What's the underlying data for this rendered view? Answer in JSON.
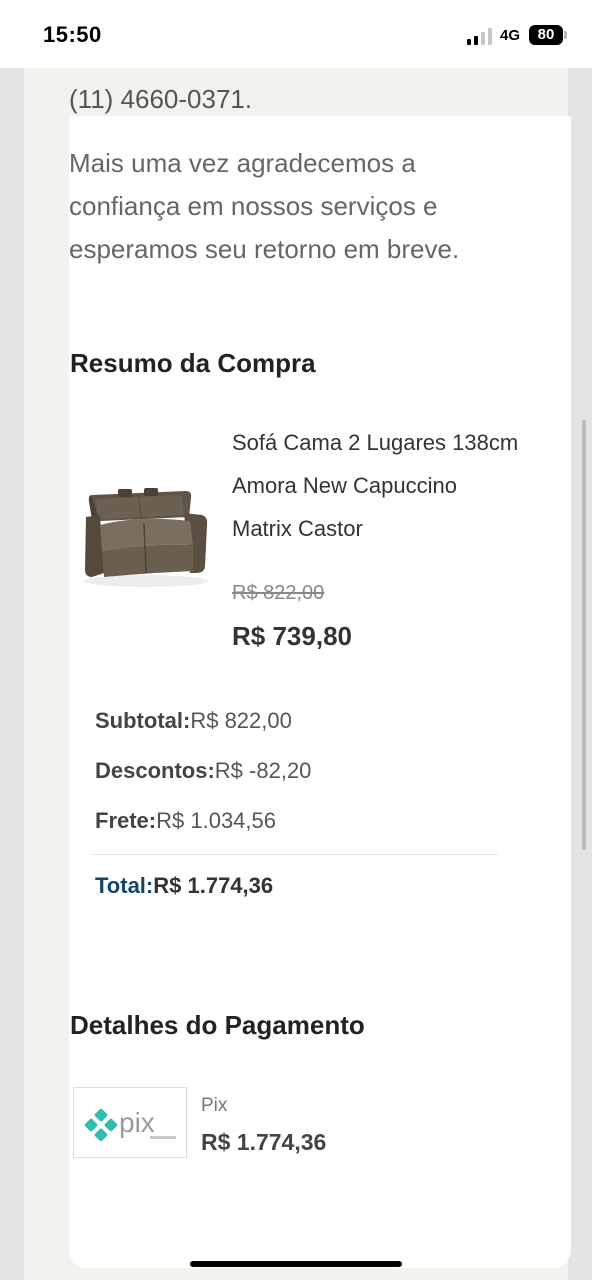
{
  "status_bar": {
    "time": "15:50",
    "network": "4G",
    "battery": "80"
  },
  "contact": {
    "phone": "(11) 4660-0371."
  },
  "thanks_message": "Mais uma vez agradecemos a confiança em nossos serviços e esperamos seu retorno em breve.",
  "purchase_summary": {
    "title": "Resumo da Compra",
    "product": {
      "image_icon": "sofa-image",
      "name": "Sofá Cama 2 Lugares 138cm Amora New Capuccino Matrix Castor",
      "old_price": "R$ 822,00",
      "price": "R$ 739,80"
    },
    "subtotal_label": "Subtotal:",
    "subtotal_value": "R$ 822,00",
    "discounts_label": "Descontos:",
    "discounts_value": "R$ -82,20",
    "shipping_label": "Frete:",
    "shipping_value": "R$ 1.034,56",
    "total_label": "Total:",
    "total_value": "R$ 1.774,36"
  },
  "payment_details": {
    "title": "Detalhes do Pagamento",
    "logo_icon": "pix-logo",
    "logo_text": "pix",
    "method": "Pix",
    "amount": "R$ 1.774,36"
  },
  "colors": {
    "total_label": "#13456a",
    "pix_teal": "#32bcad",
    "page_background": "#f3f2ef"
  }
}
